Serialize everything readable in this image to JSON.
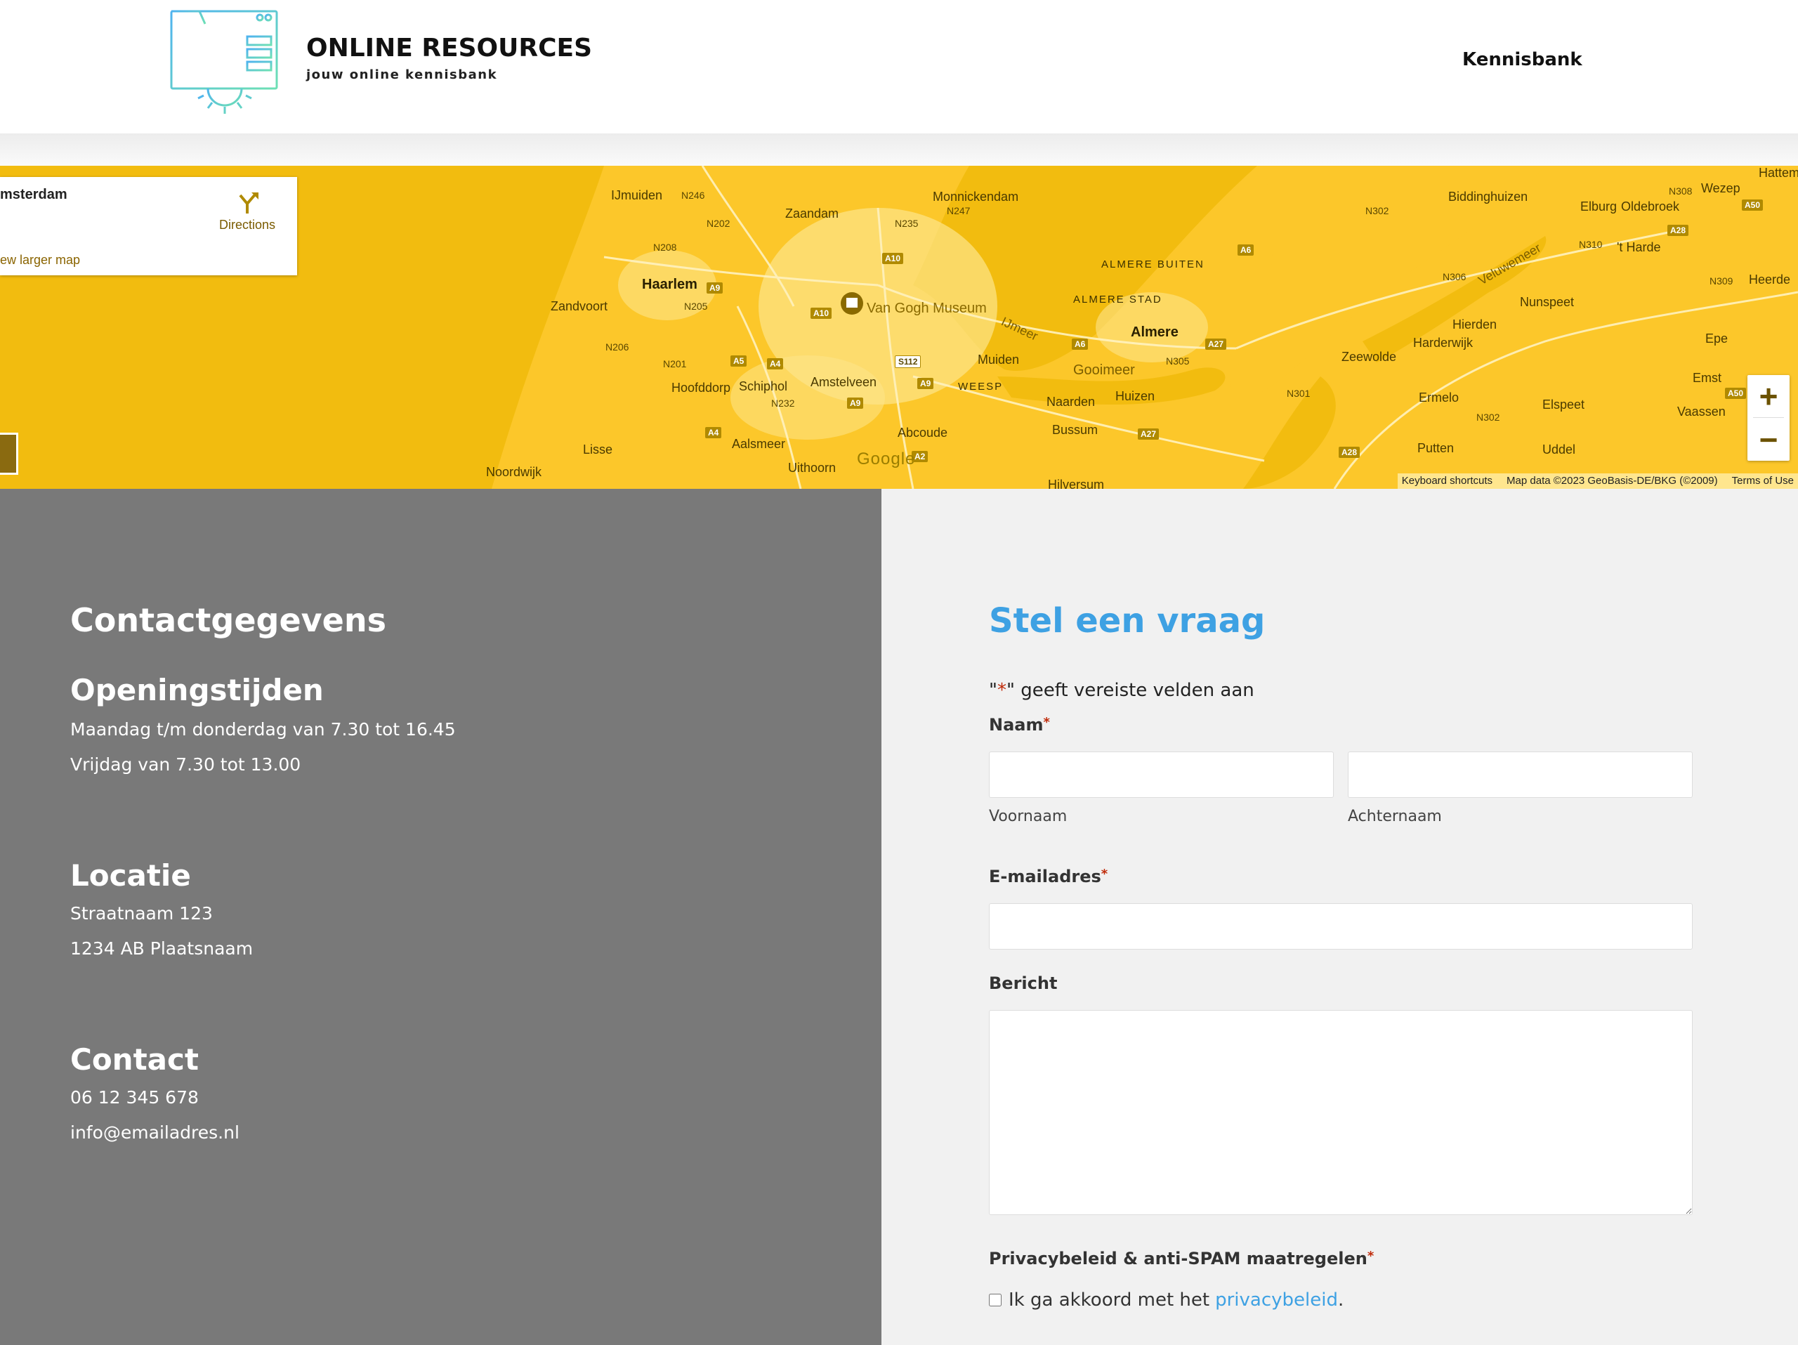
{
  "header": {
    "logo_title": "ONLINE RESOURCES",
    "logo_subtitle": "jouw online kennisbank",
    "nav": [
      {
        "label": "Kennisbank"
      }
    ]
  },
  "map": {
    "card_title": "msterdam",
    "directions_label": "Directions",
    "larger_map_label": "ew larger map",
    "zoom_in": "+",
    "zoom_out": "−",
    "google_label": "Google",
    "footer": {
      "shortcuts": "Keyboard shortcuts",
      "map_data": "Map data ©2023 GeoBasis-DE/BKG (©2009)",
      "terms": "Terms of Use"
    },
    "places": [
      "IJmuiden",
      "Zaandam",
      "Monnickendam",
      "Biddinghuizen",
      "Elburg",
      "Oldebroek",
      "Wezep",
      "Hattem",
      "Haarlem",
      "Zandvoort",
      "Van Gogh Museum",
      "ALMERE BUITEN",
      "ALMERE STAD",
      "Almere",
      "Veluwemeer",
      "'t Harde",
      "Heerde",
      "Nunspeet",
      "Hierden",
      "Harderwijk",
      "Epe",
      "Zeewolde",
      "Muiden",
      "IJmeer",
      "Gooimeer",
      "Hoofddorp",
      "Schiphol",
      "Amstelveen",
      "WEESP",
      "Naarden",
      "Huizen",
      "Ermelo",
      "Elspeet",
      "Emst",
      "Vaassen",
      "Abcoude",
      "Bussum",
      "Lisse",
      "Aalsmeer",
      "Uithoorn",
      "Putten",
      "Uddel",
      "Noordwijk",
      "Hilversum"
    ],
    "roads": [
      "N246",
      "N202",
      "N235",
      "N247",
      "N302",
      "N308",
      "A50",
      "N208",
      "A10",
      "A6",
      "A28",
      "N310",
      "A9",
      "N205",
      "N306",
      "N309",
      "A10",
      "N206",
      "A6",
      "A27",
      "N201",
      "A5",
      "A4",
      "S112",
      "N305",
      "N232",
      "A9",
      "A9",
      "N301",
      "N302",
      "A4",
      "A2",
      "A27",
      "A28",
      "A50"
    ]
  },
  "contact": {
    "heading": "Contactgegevens",
    "hours_heading": "Openingstijden",
    "hours": [
      "Maandag t/m donderdag van 7.30 tot 16.45",
      "Vrijdag van 7.30 tot 13.00"
    ],
    "location_heading": "Locatie",
    "address": [
      "Straatnaam 123",
      "1234 AB  Plaatsnaam"
    ],
    "contact_heading": "Contact",
    "phone": "06 12 345 678",
    "email": "info@emailadres.nl"
  },
  "form": {
    "title": "Stel een vraag",
    "required_note_quote_open": "\"",
    "required_note_star": "*",
    "required_note_rest": "\" geeft vereiste velden aan",
    "name_label": "Naam",
    "required_mark": "*",
    "first_name_sublabel": "Voornaam",
    "last_name_sublabel": "Achternaam",
    "first_name_value": "",
    "last_name_value": "",
    "email_label": "E-mailadres",
    "email_value": "",
    "message_label": "Bericht",
    "message_value": "",
    "privacy_label": "Privacybeleid & anti-SPAM maatregelen",
    "consent_text": "Ik ga akkoord met het",
    "consent_link": "privacybeleid",
    "consent_period": ".",
    "consent_checked": false
  },
  "colors": {
    "accent": "#3ea1e3",
    "map_base": "#f2bc0f",
    "contact_panel": "#797979",
    "form_panel": "#f1f1f1",
    "required": "#c02b0a"
  }
}
